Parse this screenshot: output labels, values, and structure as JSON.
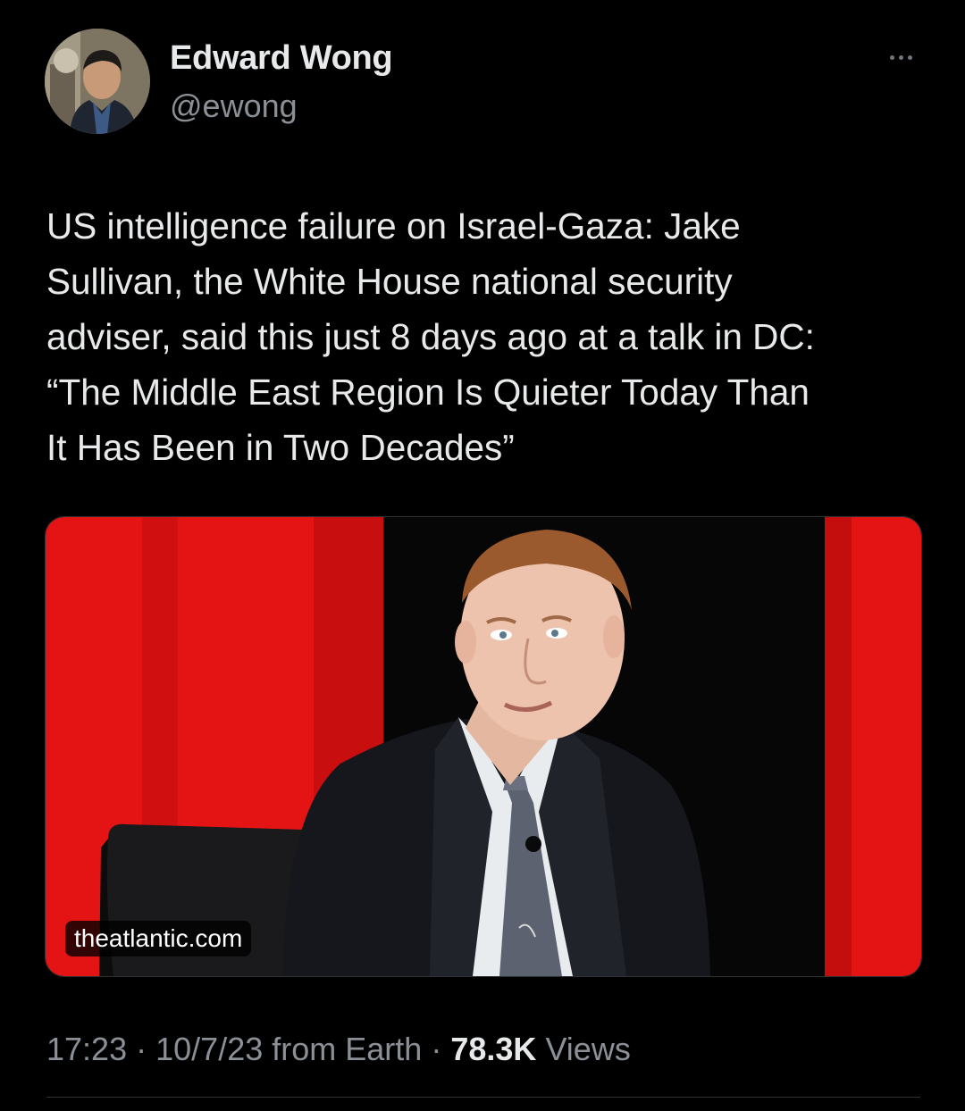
{
  "author": {
    "display_name": "Edward Wong",
    "handle": "@ewong"
  },
  "menu_icon": "more-horizontal-icon",
  "tweet": {
    "text": "US intelligence failure on Israel-Gaza: Jake\nSullivan, the White House national security\nadviser, said this just 8 days ago at a talk in DC:\n“The Middle East Region Is Quieter Today Than\nIt Has Been in Two Decades”"
  },
  "media": {
    "domain": "theatlantic.com"
  },
  "meta": {
    "time": "17:23",
    "separator": "·",
    "date": "10/7/23",
    "source": "from Earth",
    "views_count": "78.3K",
    "views_label": "Views"
  },
  "colors": {
    "background": "#000000",
    "text": "#e7e9ea",
    "secondary_text": "#8b9096",
    "stage_red": "#e51414"
  }
}
